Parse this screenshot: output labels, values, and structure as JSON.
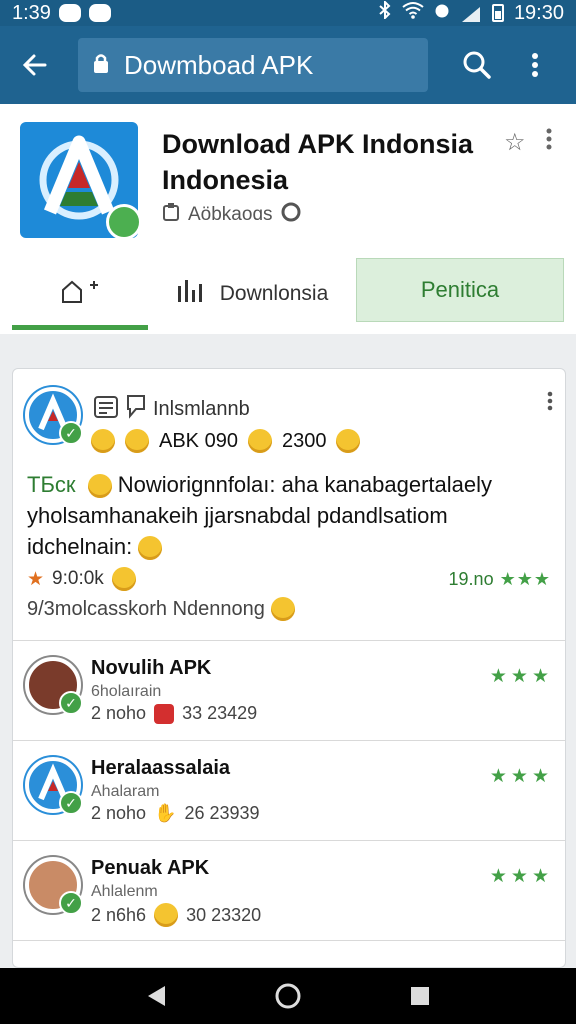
{
  "status_bar": {
    "time": "1:39",
    "right_time": "19:30"
  },
  "app_bar": {
    "search_text": "Dowmboad APK"
  },
  "app_header": {
    "title": "Download APK Indonsia Indonesia",
    "publisher": "Aöbkaoɑs"
  },
  "tabs": [
    {
      "label": ""
    },
    {
      "label": "Downlonsia"
    },
    {
      "label": "Penitica"
    }
  ],
  "post": {
    "author": "Inlsmlannb",
    "stats_a": "ABK 090",
    "stats_b": "2300",
    "tag": "TБcк",
    "body_line1": "Nowiorignnfolaı: aha kanabagertalaely",
    "body_line2": "yholsamhanakeih jjarsnabdal pdandlsatiom",
    "body_line3": "idchelnain:",
    "rating": "9:0:0k",
    "right_stat": "19.no",
    "right_stars": "★★★",
    "footnote": "9/3molcasskorh Ndennong"
  },
  "list": [
    {
      "name": "Novulih APK",
      "sub": "6holaırain",
      "meta_a": "2 noho",
      "meta_b": "33 23429",
      "stars": "★★★",
      "kind": "app"
    },
    {
      "name": "Heralaassalaia",
      "sub": "Ahalaram",
      "meta_a": "2 noho",
      "meta_b": "26 23939",
      "stars": "★★★",
      "kind": "app"
    },
    {
      "name": "Penuak APK",
      "sub": "Ahlalenm",
      "meta_a": "2 n6h6",
      "meta_b": "30 23320",
      "stars": "★★★",
      "kind": "person"
    }
  ],
  "icons": {
    "back": "arrow-left-icon",
    "search": "search-icon",
    "more": "more-vert-icon",
    "favorite": "star-outline-icon",
    "home_tab": "home-plus-icon",
    "chart_tab": "bar-chart-icon"
  },
  "colors": {
    "app_bar": "#1f6390",
    "status_bar": "#1b5c86",
    "accent_green": "#43a047",
    "selected_tab_bg": "#dcefdc"
  }
}
